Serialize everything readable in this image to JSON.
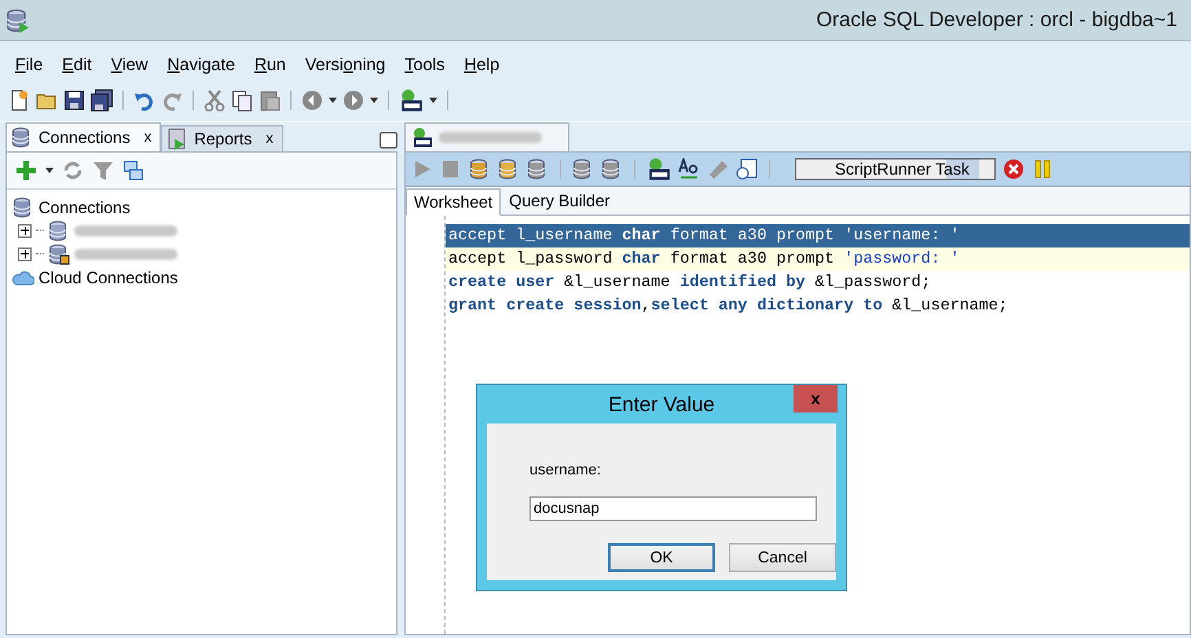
{
  "window": {
    "title": "Oracle SQL Developer : orcl - bigdba~1"
  },
  "menu": [
    {
      "key": "F",
      "after": "ile"
    },
    {
      "key": "E",
      "after": "dit"
    },
    {
      "key": "V",
      "after": "iew"
    },
    {
      "key": "N",
      "after": "avigate"
    },
    {
      "key": "R",
      "after": "un"
    },
    {
      "before": "Versi",
      "key": "o",
      "after": "ning"
    },
    {
      "key": "T",
      "after": "ools"
    },
    {
      "key": "H",
      "after": "elp"
    }
  ],
  "left_panel": {
    "tabs": [
      {
        "label": "Connections",
        "close": "x",
        "selected": true
      },
      {
        "label": "Reports",
        "close": "x",
        "selected": false
      }
    ],
    "tree": [
      {
        "label": "Connections",
        "kind": "connections",
        "expanded": true,
        "children": [
          {
            "kind": "database",
            "expanded": false
          },
          {
            "kind": "connection",
            "expanded": false
          }
        ]
      },
      {
        "label": "Cloud Connections",
        "kind": "cloud"
      }
    ]
  },
  "editor": {
    "task": {
      "label": "ScriptRunner Task"
    },
    "subtabs": [
      {
        "label": "Worksheet",
        "selected": true
      },
      {
        "label": "Query Builder",
        "selected": false
      }
    ],
    "lines": [
      {
        "selected": true,
        "current": false,
        "tokens": [
          {
            "text": "accept l_username ",
            "kind": "plain"
          },
          {
            "text": "char",
            "kind": "keyword"
          },
          {
            "text": " format a30 prompt ",
            "kind": "plain"
          },
          {
            "text": "'username: '",
            "kind": "string"
          }
        ]
      },
      {
        "selected": false,
        "current": true,
        "tokens": [
          {
            "text": "accept l_password ",
            "kind": "plain"
          },
          {
            "text": "char",
            "kind": "keyword"
          },
          {
            "text": " format a30 prompt ",
            "kind": "plain"
          },
          {
            "text": "'password: '",
            "kind": "string"
          }
        ]
      },
      {
        "selected": false,
        "current": false,
        "tokens": [
          {
            "text": "create user",
            "kind": "keyword"
          },
          {
            "text": " &l_username ",
            "kind": "plain"
          },
          {
            "text": "identified by",
            "kind": "keyword"
          },
          {
            "text": " &l_password;",
            "kind": "plain"
          }
        ]
      },
      {
        "selected": false,
        "current": false,
        "tokens": [
          {
            "text": "grant create session",
            "kind": "keyword"
          },
          {
            "text": ",",
            "kind": "plain"
          },
          {
            "text": "select any dictionary to",
            "kind": "keyword"
          },
          {
            "text": " &l_username;",
            "kind": "plain"
          }
        ]
      }
    ]
  },
  "dialog": {
    "title": "Enter Value",
    "close": "x",
    "label": "username:",
    "value": "docusnap",
    "buttons": [
      {
        "label": "OK",
        "default": true
      },
      {
        "label": "Cancel",
        "default": false
      }
    ]
  }
}
